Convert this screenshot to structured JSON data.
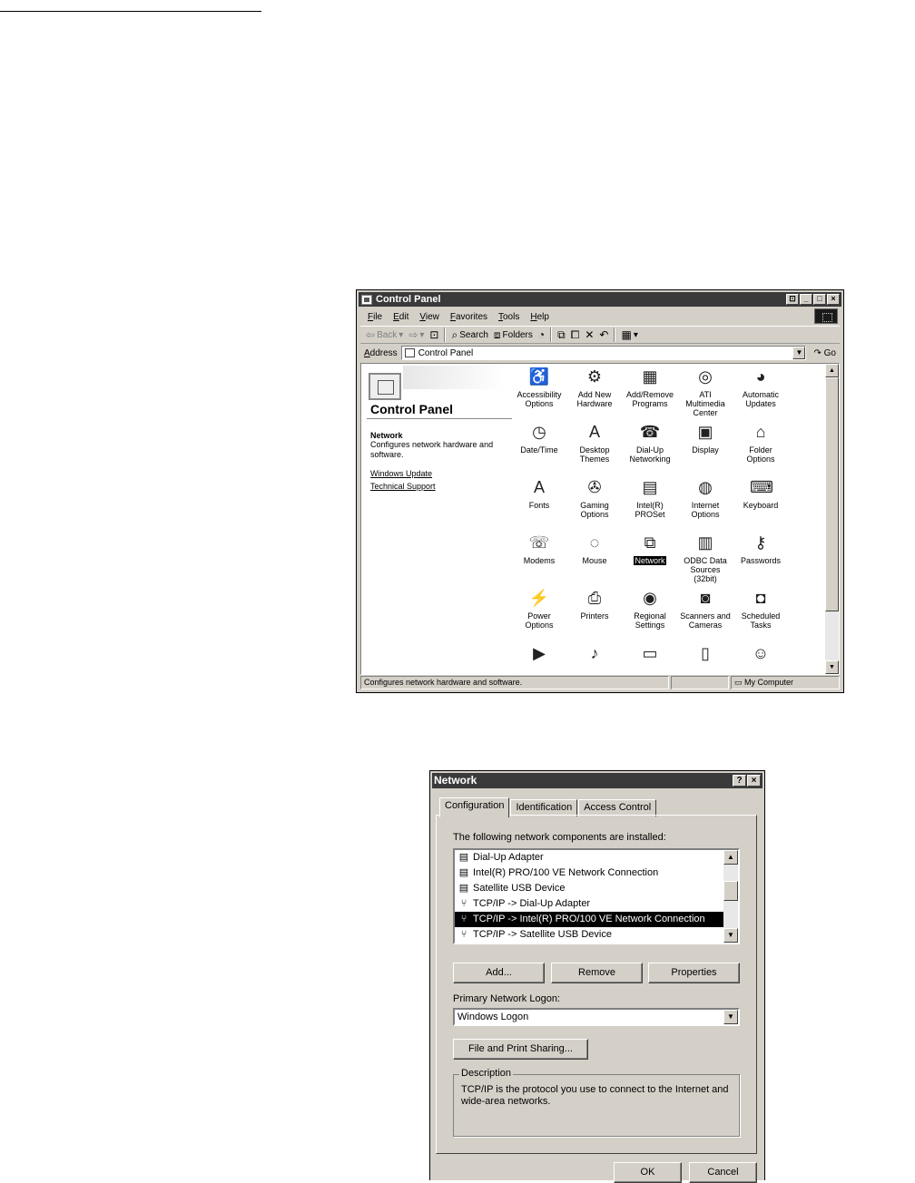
{
  "control_panel": {
    "title": "Control Panel",
    "window_buttons": [
      "⊡",
      "_",
      "□",
      "×"
    ],
    "menu": [
      "File",
      "Edit",
      "View",
      "Favorites",
      "Tools",
      "Help"
    ],
    "toolbar": {
      "back": "Back",
      "search": "Search",
      "folders": "Folders"
    },
    "address": {
      "label": "Address",
      "value": "Control Panel",
      "go": "Go"
    },
    "left_pane": {
      "title": "Control Panel",
      "selected_name": "Network",
      "selected_description": "Configures network hardware and software.",
      "links": [
        "Windows Update",
        "Technical Support"
      ]
    },
    "icons": [
      {
        "label": "Accessibility Options",
        "icon": "accessibility-icon",
        "glyph": "♿"
      },
      {
        "label": "Add New Hardware",
        "icon": "hardware-icon",
        "glyph": "⚙"
      },
      {
        "label": "Add/Remove Programs",
        "icon": "programs-icon",
        "glyph": "▦"
      },
      {
        "label": "ATI Multimedia Center",
        "icon": "multimedia-icon",
        "glyph": "◎"
      },
      {
        "label": "Automatic Updates",
        "icon": "updates-icon",
        "glyph": "◕"
      },
      {
        "label": "Date/Time",
        "icon": "clock-icon",
        "glyph": "◷"
      },
      {
        "label": "Desktop Themes",
        "icon": "themes-icon",
        "glyph": "A"
      },
      {
        "label": "Dial-Up Networking",
        "icon": "dialup-icon",
        "glyph": "☎"
      },
      {
        "label": "Display",
        "icon": "display-icon",
        "glyph": "▣"
      },
      {
        "label": "Folder Options",
        "icon": "folder-icon",
        "glyph": "⌂"
      },
      {
        "label": "Fonts",
        "icon": "fonts-icon",
        "glyph": "A"
      },
      {
        "label": "Gaming Options",
        "icon": "joystick-icon",
        "glyph": "✇"
      },
      {
        "label": "Intel(R) PROSet",
        "icon": "proset-icon",
        "glyph": "▤"
      },
      {
        "label": "Internet Options",
        "icon": "globe-icon",
        "glyph": "◍"
      },
      {
        "label": "Keyboard",
        "icon": "keyboard-icon",
        "glyph": "⌨"
      },
      {
        "label": "Modems",
        "icon": "modem-icon",
        "glyph": "☏"
      },
      {
        "label": "Mouse",
        "icon": "mouse-icon",
        "glyph": "◌"
      },
      {
        "label": "Network",
        "icon": "network-icon",
        "glyph": "⧉",
        "selected": true
      },
      {
        "label": "ODBC Data Sources (32bit)",
        "icon": "database-icon",
        "glyph": "▥"
      },
      {
        "label": "Passwords",
        "icon": "keys-icon",
        "glyph": "⚷"
      },
      {
        "label": "Power Options",
        "icon": "power-icon",
        "glyph": "⚡"
      },
      {
        "label": "Printers",
        "icon": "printer-icon",
        "glyph": "⎙"
      },
      {
        "label": "Regional Settings",
        "icon": "globe-icon",
        "glyph": "◉"
      },
      {
        "label": "Scanners and Cameras",
        "icon": "camera-icon",
        "glyph": "◙"
      },
      {
        "label": "Scheduled Tasks",
        "icon": "tasks-icon",
        "glyph": "◘"
      },
      {
        "label": "",
        "icon": "play-icon",
        "glyph": "▶"
      },
      {
        "label": "",
        "icon": "sound-icon",
        "glyph": "♪"
      },
      {
        "label": "",
        "icon": "system-icon",
        "glyph": "▭"
      },
      {
        "label": "",
        "icon": "taskbar-icon",
        "glyph": "▯"
      },
      {
        "label": "",
        "icon": "users-icon",
        "glyph": "☺"
      }
    ],
    "status": {
      "text": "Configures network hardware and software.",
      "zone": "My Computer"
    }
  },
  "network_dialog": {
    "title": "Network",
    "title_buttons": [
      "?",
      "×"
    ],
    "tabs": [
      "Configuration",
      "Identification",
      "Access Control"
    ],
    "components_label": "The following network components are installed:",
    "components": [
      {
        "label": "Dial-Up Adapter",
        "icon": "adapter-icon",
        "glyph": "▤"
      },
      {
        "label": "Intel(R) PRO/100 VE Network Connection",
        "icon": "adapter-icon",
        "glyph": "▤"
      },
      {
        "label": "Satellite USB Device",
        "icon": "adapter-icon",
        "glyph": "▤"
      },
      {
        "label": "TCP/IP -> Dial-Up Adapter",
        "icon": "protocol-icon",
        "glyph": "⑂"
      },
      {
        "label": "TCP/IP -> Intel(R) PRO/100 VE Network Connection",
        "icon": "protocol-icon",
        "glyph": "⑂",
        "selected": true
      },
      {
        "label": "TCP/IP -> Satellite USB Device",
        "icon": "protocol-icon",
        "glyph": "⑂"
      }
    ],
    "buttons": {
      "add": "Add...",
      "remove": "Remove",
      "properties": "Properties",
      "file_print_sharing": "File and Print Sharing...",
      "ok": "OK",
      "cancel": "Cancel"
    },
    "logon_label": "Primary Network Logon:",
    "logon_value": "Windows Logon",
    "description_legend": "Description",
    "description_text": "TCP/IP is the protocol you use to connect to the Internet and wide-area networks."
  }
}
